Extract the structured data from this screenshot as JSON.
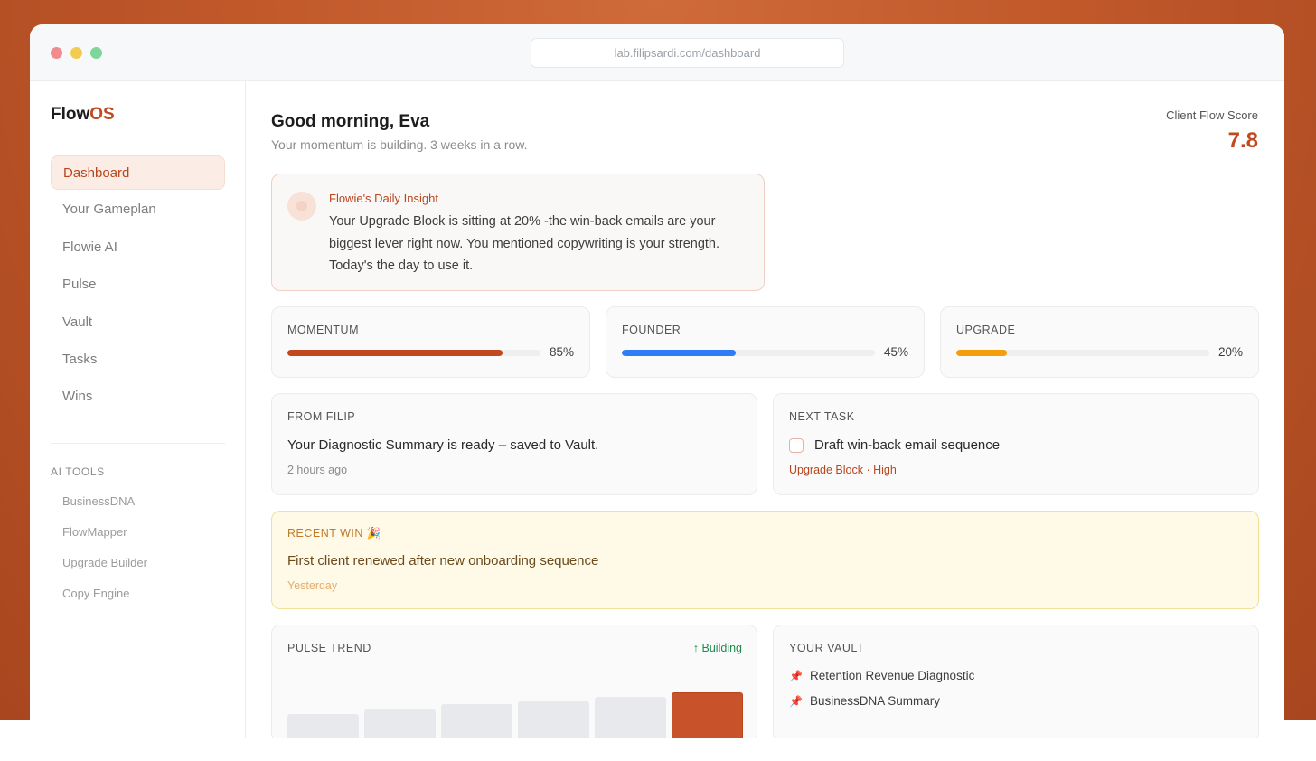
{
  "browser": {
    "url": "lab.filipsardi.com/dashboard"
  },
  "brand": {
    "name_part1": "Flow",
    "name_part2": "OS",
    "accent": "#c2491f"
  },
  "sidebar": {
    "items": [
      {
        "label": "Dashboard",
        "active": true
      },
      {
        "label": "Your Gameplan"
      },
      {
        "label": "Flowie AI"
      },
      {
        "label": "Pulse"
      },
      {
        "label": "Vault"
      },
      {
        "label": "Tasks"
      },
      {
        "label": "Wins"
      }
    ],
    "tools_heading": "AI TOOLS",
    "tools": [
      {
        "label": "BusinessDNA"
      },
      {
        "label": "FlowMapper"
      },
      {
        "label": "Upgrade Builder"
      },
      {
        "label": "Copy Engine"
      }
    ]
  },
  "header": {
    "greeting": "Good morning, Eva",
    "subtitle": "Your momentum is building. 3 weeks in a row.",
    "score_label": "Client Flow Score",
    "score_value": "7.8"
  },
  "insight": {
    "title": "Flowie's Daily Insight",
    "body": "Your Upgrade Block is sitting at 20% -the win-back emails are your biggest lever right now. You mentioned copywriting is your strength. Today's the day to use it."
  },
  "metrics": [
    {
      "label": "MOMENTUM",
      "value": 85,
      "pct": "85%",
      "color": "#c2491f"
    },
    {
      "label": "FOUNDER",
      "value": 45,
      "pct": "45%",
      "color": "#2f7cf6"
    },
    {
      "label": "UPGRADE",
      "value": 20,
      "pct": "20%",
      "color": "#f59e0b"
    }
  ],
  "from_filip": {
    "label": "FROM FILIP",
    "text": "Your Diagnostic Summary is ready – saved to Vault.",
    "meta": "2 hours ago"
  },
  "next_task": {
    "label": "NEXT TASK",
    "text": "Draft win-back email sequence",
    "meta": "Upgrade Block · High"
  },
  "recent_win": {
    "label": "RECENT WIN 🎉",
    "text": "First client renewed after new onboarding sequence",
    "meta": "Yesterday"
  },
  "pulse_trend": {
    "label": "PULSE TREND",
    "status": "↑ Building",
    "bars": [
      0.36,
      0.43,
      0.5,
      0.54,
      0.6,
      0.66
    ],
    "current_index": 5
  },
  "vault": {
    "label": "YOUR VAULT",
    "items": [
      {
        "label": "Retention Revenue Diagnostic"
      },
      {
        "label": "BusinessDNA Summary"
      }
    ]
  }
}
